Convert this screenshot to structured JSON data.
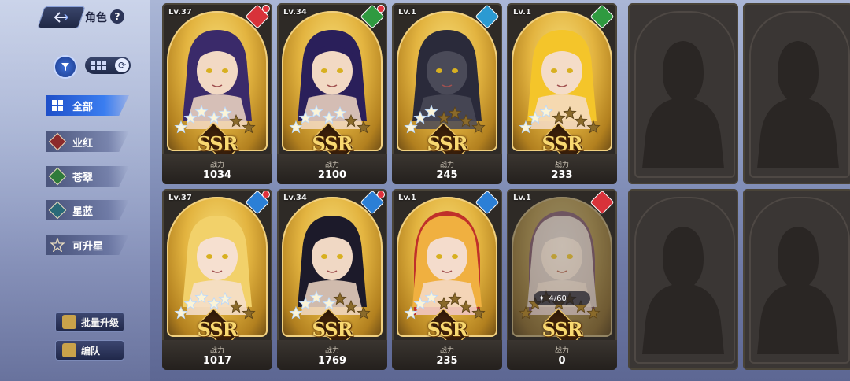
{
  "header": {
    "title": "角色",
    "help": "?"
  },
  "categories": [
    {
      "label": "全部",
      "active": true,
      "icon": "grid-icon",
      "color": "#2a62e0"
    },
    {
      "label": "业红",
      "active": false,
      "icon": "red-diamond-icon",
      "color": "#8c2a2a"
    },
    {
      "label": "苍翠",
      "active": false,
      "icon": "green-diamond-icon",
      "color": "#2f7a3a"
    },
    {
      "label": "星蓝",
      "active": false,
      "icon": "teal-diamond-icon",
      "color": "#2a6a78"
    },
    {
      "label": "可升星",
      "active": false,
      "icon": "star-upgrade-icon",
      "color": "#555a6e"
    }
  ],
  "actions": {
    "batch_upgrade": "批量升级",
    "formation": "编队"
  },
  "labels": {
    "power": "战力",
    "rarity": "SSR"
  },
  "cards": [
    {
      "level": "Lv.37",
      "power": "1034",
      "element_color": "#d8323a",
      "element_icon": "sword-icon",
      "red_dot": true,
      "stars": 5,
      "hair": "#3a2a6a",
      "skin": "#f2d9c4",
      "hood": null,
      "locked": false
    },
    {
      "level": "Lv.34",
      "power": "2100",
      "element_color": "#2f9a40",
      "element_icon": "leaf-icon",
      "red_dot": true,
      "stars": 5,
      "hair": "#2a1f5a",
      "skin": "#f2d9c4",
      "hood": null,
      "locked": false
    },
    {
      "level": "Lv.1",
      "power": "245",
      "element_color": "#2b9ad2",
      "element_icon": "shield-icon",
      "red_dot": false,
      "stars": 3,
      "hair": "#2a2a3a",
      "skin": "#4a4a58",
      "hood": null,
      "locked": false
    },
    {
      "level": "Lv.1",
      "power": "233",
      "element_color": "#2f9a40",
      "element_icon": "leaf-icon",
      "red_dot": false,
      "stars": 3,
      "hair": "#f4c52a",
      "skin": "#f4dcc8",
      "hood": null,
      "locked": false
    },
    {
      "level": "Lv.37",
      "power": "1017",
      "element_color": "#2b7fd6",
      "element_icon": "staff-icon",
      "red_dot": true,
      "stars": 5,
      "hair": "#f2d16a",
      "skin": "#f6e0d0",
      "hood": null,
      "locked": false
    },
    {
      "level": "Lv.34",
      "power": "1769",
      "element_color": "#2b7fd6",
      "element_icon": "sword-icon",
      "red_dot": true,
      "stars": 4,
      "hair": "#1c1a2a",
      "skin": "#f0d8c4",
      "hood": null,
      "locked": false
    },
    {
      "level": "Lv.1",
      "power": "235",
      "element_color": "#2b7fd6",
      "element_icon": "flame-icon",
      "red_dot": false,
      "stars": 3,
      "hair": "#f0b040",
      "skin": "#f4dccc",
      "hood": "#c0302a",
      "locked": false
    },
    {
      "level": "Lv.1",
      "power": "0",
      "element_color": "#d8323a",
      "element_icon": "sword-icon",
      "red_dot": false,
      "stars": 0,
      "hair": "#c8c0d0",
      "skin": "#e8dce4",
      "hood": "#5a3a6a",
      "locked": true,
      "shards": "4/60"
    }
  ],
  "empty_slots": 4
}
